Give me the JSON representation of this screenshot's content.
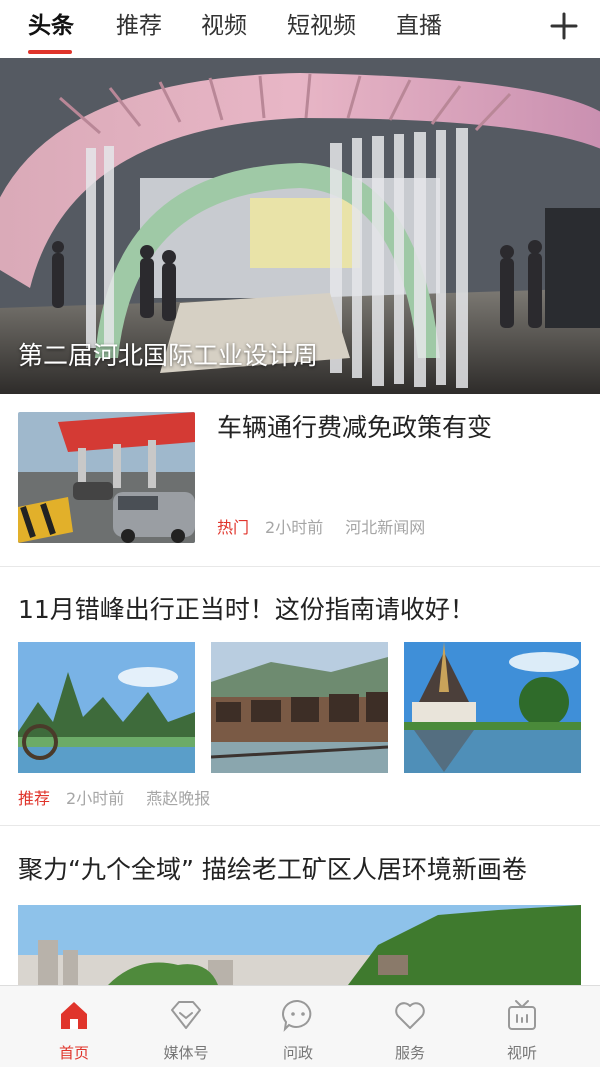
{
  "tabs": [
    {
      "label": "头条",
      "active": true
    },
    {
      "label": "推荐",
      "active": false
    },
    {
      "label": "视频",
      "active": false
    },
    {
      "label": "短视频",
      "active": false
    },
    {
      "label": "直播",
      "active": false
    }
  ],
  "tabbar": {
    "add_icon": "plus-icon"
  },
  "hero": {
    "title": "第二届河北国际工业设计周",
    "slide_count": 4,
    "active_slide": 1
  },
  "articles": [
    {
      "title": "车辆通行费减免政策有变",
      "tag": "热门",
      "time": "2小时前",
      "source": "河北新闻网"
    },
    {
      "title": "11月错峰出行正当时！这份指南请收好！",
      "tag": "推荐",
      "time": "2小时前",
      "source": "燕赵晚报"
    },
    {
      "title": "聚力“九个全域” 描绘老工矿区人居环境新画卷"
    }
  ],
  "bottom_nav": [
    {
      "label": "首页",
      "icon": "home-icon",
      "active": true
    },
    {
      "label": "媒体号",
      "icon": "media-diamond-icon",
      "active": false
    },
    {
      "label": "问政",
      "icon": "chat-bubble-icon",
      "active": false
    },
    {
      "label": "服务",
      "icon": "heart-icon",
      "active": false
    },
    {
      "label": "视听",
      "icon": "tv-icon",
      "active": false
    }
  ],
  "colors": {
    "accent": "#e0342b",
    "meta_text": "#a6a6a6",
    "nav_bg": "#f7f7f7"
  }
}
